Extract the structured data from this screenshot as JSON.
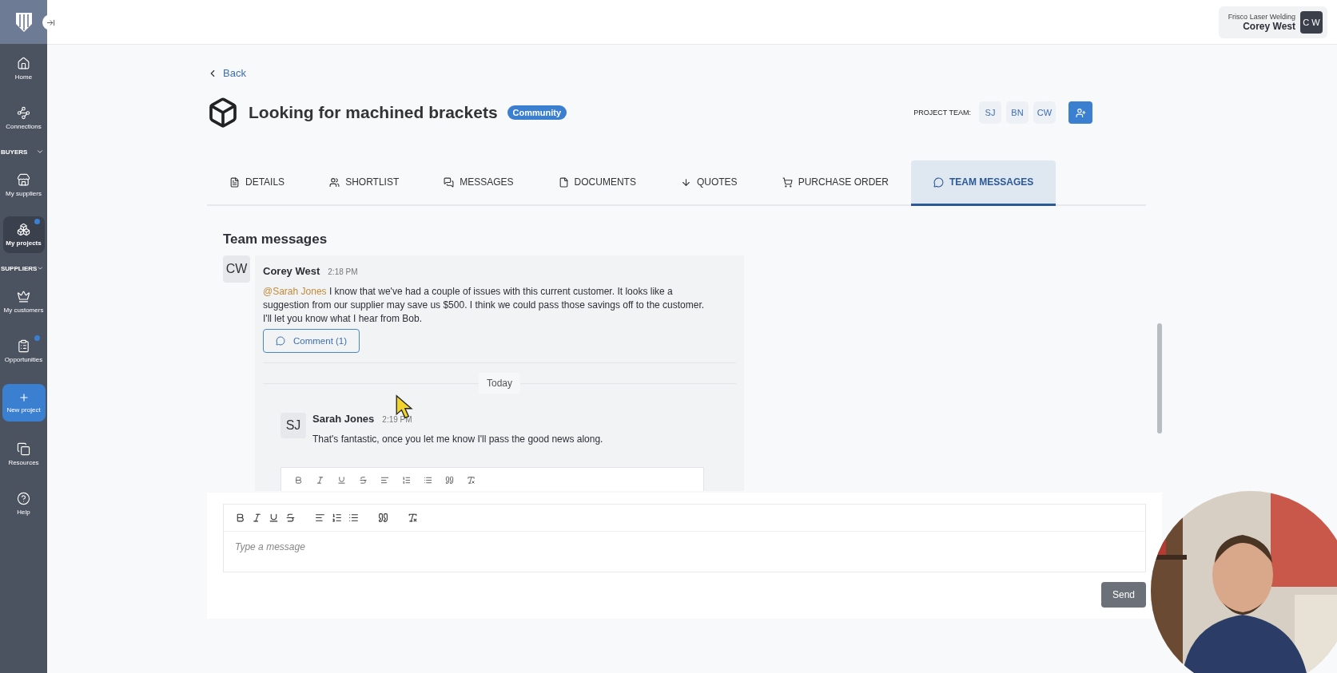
{
  "sidebar": {
    "items": [
      {
        "kind": "link",
        "label": "Home",
        "selected": false,
        "notification": false
      },
      {
        "kind": "link",
        "label": "Connections",
        "selected": false,
        "notification": false
      },
      {
        "kind": "section",
        "label": "BUYERS"
      },
      {
        "kind": "link",
        "label": "My suppliers",
        "selected": false,
        "notification": false
      },
      {
        "kind": "link",
        "label": "My projects",
        "selected": true,
        "notification": true
      },
      {
        "kind": "section",
        "label": "SUPPLIERS"
      },
      {
        "kind": "link",
        "label": "My customers",
        "selected": false,
        "notification": false
      },
      {
        "kind": "link",
        "label": "Opportunities",
        "selected": false,
        "notification": true
      },
      {
        "kind": "action",
        "label": "New project"
      },
      {
        "kind": "link",
        "label": "Resources",
        "selected": false,
        "notification": false
      },
      {
        "kind": "link",
        "label": "Help",
        "selected": false,
        "notification": false
      }
    ]
  },
  "account": {
    "company": "Frisco Laser Welding",
    "name": "Corey West",
    "initials": "C W"
  },
  "back": "Back",
  "project": {
    "title": "Looking for machined brackets",
    "tag": "Community",
    "team_label": "PROJECT TEAM:",
    "team": [
      "SJ",
      "BN",
      "CW"
    ]
  },
  "tabs": [
    {
      "label": "DETAILS",
      "selected": false
    },
    {
      "label": "SHORTLIST",
      "selected": false
    },
    {
      "label": "MESSAGES",
      "selected": false
    },
    {
      "label": "DOCUMENTS",
      "selected": false
    },
    {
      "label": "QUOTES",
      "selected": false
    },
    {
      "label": "PURCHASE ORDER",
      "selected": false
    },
    {
      "label": "TEAM MESSAGES",
      "selected": true
    }
  ],
  "team_messages": {
    "heading": "Team messages",
    "thread": [
      {
        "kind": "message",
        "initials": "CW",
        "author": "Corey West",
        "time": "2:18 PM",
        "mention": "@Sarah Jones",
        "text": "I know that we've had a couple of issues with this current customer. It looks like a suggestion from our supplier may save us $500. I think we could pass those savings off to the customer. I'll let you know what I hear from Bob.",
        "comment_button": "Comment (1)"
      },
      {
        "kind": "divider",
        "label": "Today"
      },
      {
        "kind": "reply",
        "initials": "SJ",
        "author": "Sarah Jones",
        "time": "2:19 PM",
        "text": "That's fantastic, once you let me know I'll pass the good news along."
      }
    ]
  },
  "composer": {
    "placeholder": "Type a message",
    "send": "Send"
  }
}
